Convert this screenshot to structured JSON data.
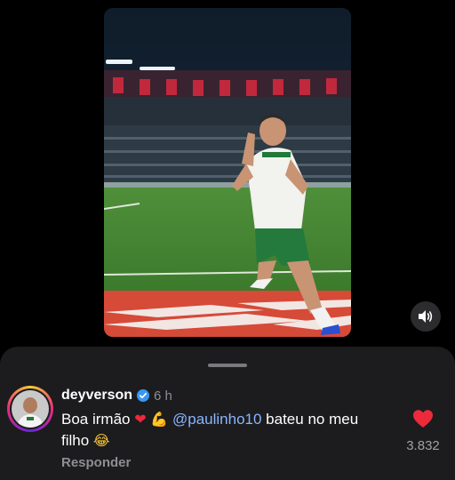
{
  "video": {
    "description_icon": "soccer-celebration-video",
    "sound_icon": "speaker-icon"
  },
  "comment": {
    "username": "deyverson",
    "verified_icon": "verified-badge-icon",
    "time": "6 h",
    "text_part1": "Boa irmão ",
    "emoji_heart": "❤",
    "emoji_muscle": "💪",
    "mention": "@paulinho10",
    "text_part2": " bateu no meu filho ",
    "emoji_laugh": "😂",
    "reply_label": "Responder",
    "like_count": "3.832"
  },
  "colors": {
    "background": "#000000",
    "sheet": "#1c1c1e",
    "like_red": "#ed2a3a",
    "mention_blue": "#8ab4ff",
    "verified_blue": "#3897f0"
  }
}
